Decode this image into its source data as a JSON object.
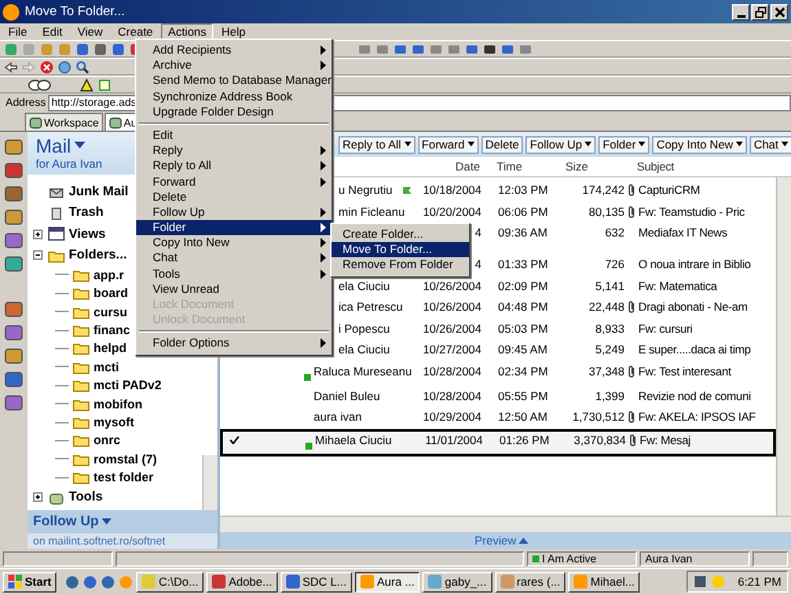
{
  "window": {
    "title": "Move To Folder..."
  },
  "menu_bar": [
    {
      "label": "File",
      "selected": false
    },
    {
      "label": "Edit",
      "selected": false
    },
    {
      "label": "View",
      "selected": false
    },
    {
      "label": "Create",
      "selected": false
    },
    {
      "label": "Actions",
      "selected": true
    },
    {
      "label": "Help",
      "selected": false
    }
  ],
  "actions_menu": [
    [
      {
        "label": "Add Recipients",
        "submenu": true,
        "disabled": false,
        "selected": false
      },
      {
        "label": "Archive",
        "submenu": true,
        "disabled": false,
        "selected": false
      },
      {
        "label": "Send Memo to Database Manager",
        "submenu": false,
        "disabled": false,
        "selected": false
      },
      {
        "label": "Synchronize Address Book",
        "submenu": false,
        "disabled": false,
        "selected": false
      },
      {
        "label": "Upgrade Folder Design",
        "submenu": false,
        "disabled": false,
        "selected": false
      }
    ],
    [
      {
        "label": "Edit",
        "submenu": false,
        "disabled": false,
        "selected": false
      },
      {
        "label": "Reply",
        "submenu": true,
        "disabled": false,
        "selected": false
      },
      {
        "label": "Reply to All",
        "submenu": true,
        "disabled": false,
        "selected": false
      },
      {
        "label": "Forward",
        "submenu": true,
        "disabled": false,
        "selected": false
      },
      {
        "label": "Delete",
        "submenu": false,
        "disabled": false,
        "selected": false
      },
      {
        "label": "Follow Up",
        "submenu": true,
        "disabled": false,
        "selected": false
      },
      {
        "label": "Folder",
        "submenu": true,
        "disabled": false,
        "selected": true
      },
      {
        "label": "Copy Into New",
        "submenu": true,
        "disabled": false,
        "selected": false
      },
      {
        "label": "Chat",
        "submenu": true,
        "disabled": false,
        "selected": false
      },
      {
        "label": "Tools",
        "submenu": true,
        "disabled": false,
        "selected": false
      },
      {
        "label": "View Unread",
        "submenu": false,
        "disabled": false,
        "selected": false
      },
      {
        "label": "Lock Document",
        "submenu": false,
        "disabled": true,
        "selected": false
      },
      {
        "label": "Unlock Document",
        "submenu": false,
        "disabled": true,
        "selected": false
      }
    ],
    [
      {
        "label": "Folder Options",
        "submenu": true,
        "disabled": false,
        "selected": false
      }
    ]
  ],
  "folder_submenu": [
    {
      "label": "Create Folder...",
      "selected": false
    },
    {
      "label": "Move To Folder...",
      "selected": true
    },
    {
      "label": "Remove From Folder",
      "selected": false
    }
  ],
  "address": {
    "label": "Address",
    "value": "http://storage.ads"
  },
  "tabs": [
    {
      "label": "Workspace",
      "selected": false
    },
    {
      "label": "Au",
      "selected": true
    }
  ],
  "nav": {
    "title": "Mail",
    "subtitle": "for Aura Ivan",
    "items": [
      {
        "label": "Junk Mail",
        "kind": "junk"
      },
      {
        "label": "Trash",
        "kind": "trash"
      },
      {
        "label": "Views",
        "kind": "views",
        "expanded": false
      },
      {
        "label": "Folders...",
        "kind": "folder",
        "expanded": true,
        "children": [
          {
            "label": "app.r"
          },
          {
            "label": "board"
          },
          {
            "label": "cursu"
          },
          {
            "label": "financ"
          },
          {
            "label": "helpd"
          },
          {
            "label": "mcti"
          },
          {
            "label": "mcti PADv2"
          },
          {
            "label": "mobifon"
          },
          {
            "label": "mysoft"
          },
          {
            "label": "onrc"
          },
          {
            "label": "romstal (7)"
          },
          {
            "label": "test folder"
          }
        ]
      },
      {
        "label": "Tools",
        "kind": "tools",
        "expanded": false
      }
    ],
    "footer_title": "Follow Up",
    "footer_text": "on mailint.softnet.ro/softnet"
  },
  "action_bar": [
    {
      "label": "Reply to All",
      "dropdown": true
    },
    {
      "label": "Forward",
      "dropdown": true
    },
    {
      "label": "Delete",
      "dropdown": false
    },
    {
      "label": "Follow Up",
      "dropdown": true
    },
    {
      "label": "Folder",
      "dropdown": true
    },
    {
      "label": "Copy Into New",
      "dropdown": true
    },
    {
      "label": "Chat",
      "dropdown": true
    }
  ],
  "columns": [
    "Date",
    "Time",
    "Size",
    "Subject"
  ],
  "rows": [
    {
      "sender": "u Negrutiu",
      "kind": "flagged",
      "date": "10/18/2004",
      "time": "12:03 PM",
      "size": "174,242",
      "attachment": true,
      "subject": "CapturiCRM",
      "checked": false,
      "selected": false
    },
    {
      "sender": "min Ficleanu",
      "kind": "plain",
      "date": "10/20/2004",
      "time": "06:06 PM",
      "size": "80,135",
      "attachment": true,
      "subject": "Fw: Teamstudio - Pric",
      "checked": false,
      "selected": false
    },
    {
      "sender": "",
      "kind": "plain",
      "date": "4",
      "time": "09:36 AM",
      "size": "632",
      "attachment": false,
      "subject": "Mediafax IT News",
      "checked": false,
      "selected": false
    },
    {
      "sender": "",
      "kind": "plain",
      "date": "4",
      "time": "01:33 PM",
      "size": "726",
      "attachment": false,
      "subject": "O noua intrare in Biblio",
      "checked": false,
      "selected": false
    },
    {
      "sender": "ela Ciuciu",
      "kind": "plain",
      "date": "10/26/2004",
      "time": "02:09 PM",
      "size": "5,141",
      "attachment": false,
      "subject": "Fw: Matematica",
      "checked": false,
      "selected": false
    },
    {
      "sender": "ica Petrescu",
      "kind": "plain",
      "date": "10/26/2004",
      "time": "04:48 PM",
      "size": "22,448",
      "attachment": true,
      "subject": "Dragi abonati -  Ne-am",
      "checked": false,
      "selected": false
    },
    {
      "sender": "i Popescu",
      "kind": "plain",
      "date": "10/26/2004",
      "time": "05:03 PM",
      "size": "8,933",
      "attachment": false,
      "subject": "Fw: cursuri",
      "checked": false,
      "selected": false
    },
    {
      "sender": "ela Ciuciu",
      "kind": "plain",
      "date": "10/27/2004",
      "time": "09:45 AM",
      "size": "5,249",
      "attachment": false,
      "subject": "E super.....daca ai timp",
      "checked": false,
      "selected": false
    },
    {
      "sender": "Raluca Mureseanu",
      "kind": "marked",
      "date": "10/28/2004",
      "time": "02:34 PM",
      "size": "37,348",
      "attachment": true,
      "subject": "Fw: Test interesant",
      "checked": false,
      "selected": false
    },
    {
      "sender": "Daniel Buleu",
      "kind": "plain",
      "date": "10/28/2004",
      "time": "05:55 PM",
      "size": "1,399",
      "attachment": false,
      "subject": "Revizie nod de comuni",
      "checked": false,
      "selected": false
    },
    {
      "sender": "aura ivan",
      "kind": "plain",
      "date": "10/29/2004",
      "time": "12:50 AM",
      "size": "1,730,512",
      "attachment": true,
      "subject": "Fw: AKELA: IPSOS IAF",
      "checked": false,
      "selected": false
    },
    {
      "sender": "Mihaela Ciuciu",
      "kind": "marked",
      "date": "11/01/2004",
      "time": "01:26 PM",
      "size": "3,370,834",
      "attachment": true,
      "subject": "Fw: Mesaj",
      "checked": true,
      "selected": true
    }
  ],
  "preview_label": "Preview",
  "status_bar": {
    "presence": "I Am Active",
    "user": "Aura Ivan"
  },
  "taskbar": {
    "start": "Start",
    "buttons": [
      {
        "label": "C:\\Do...",
        "selected": false
      },
      {
        "label": "Adobe...",
        "selected": false
      },
      {
        "label": "SDC L...",
        "selected": false
      },
      {
        "label": "Aura ...",
        "selected": true
      },
      {
        "label": "gaby_...",
        "selected": false
      },
      {
        "label": "rares (...",
        "selected": false
      },
      {
        "label": "Mihael...",
        "selected": false
      }
    ],
    "clock": "6:21 PM"
  }
}
